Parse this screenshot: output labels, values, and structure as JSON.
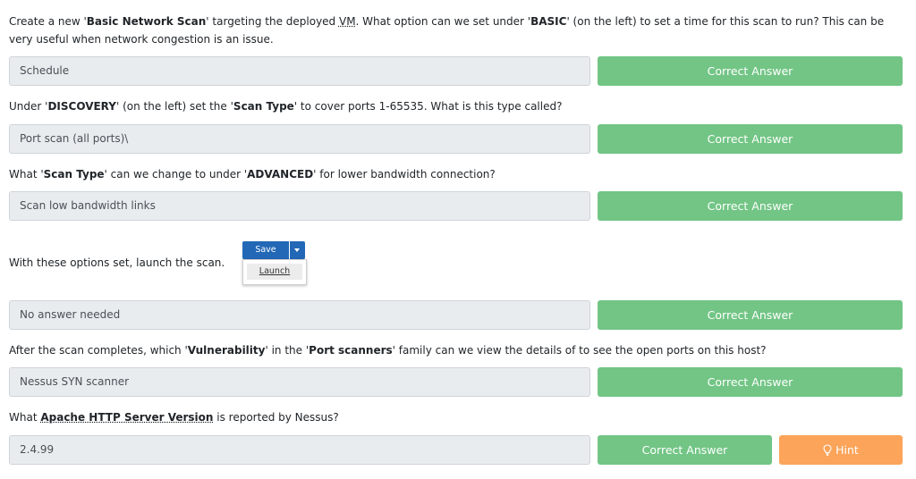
{
  "questions": [
    {
      "q_parts": [
        "Create a new '",
        "Basic Network Scan",
        "' targeting the deployed ",
        "VM",
        ". What option can we set under '",
        "BASIC",
        "' (on the left) to set a time for this scan to run? This can be very useful when network congestion is an issue."
      ],
      "answer": "Schedule",
      "button": "Correct Answer"
    },
    {
      "q_parts": [
        "Under '",
        "DISCOVERY",
        "' (on the left) set the '",
        "Scan Type",
        "' to cover ports 1-65535. What is this type called?"
      ],
      "answer": "Port scan (all ports)\\",
      "button": "Correct Answer"
    },
    {
      "q_parts": [
        "What '",
        "Scan Type",
        "' can we change to under '",
        "ADVANCED",
        "' for lower bandwidth connection?"
      ],
      "answer": "Scan low bandwidth links",
      "button": "Correct Answer"
    },
    {
      "q_text": "With these options set,  launch the scan.",
      "answer": "No answer needed",
      "button": "Correct Answer"
    },
    {
      "q_parts": [
        "After the scan completes, which '",
        "Vulnerability",
        "' in the '",
        "Port scanners",
        "' family can we view the details of to see the open ports on this host?"
      ],
      "answer": "Nessus SYN scanner",
      "button": "Correct Answer"
    },
    {
      "q_parts": [
        "What ",
        "Apache HTTP Server Version",
        " is reported by Nessus?"
      ],
      "answer": "2.4.99",
      "button": "Correct Answer",
      "hint": "Hint"
    }
  ],
  "nessus_widget": {
    "save": "Save",
    "launch": "Launch"
  },
  "colors": {
    "correct": "#72c585",
    "hint": "#fba45a",
    "save": "#2268b6",
    "answer_bg": "#e9ecef"
  },
  "icons": {
    "hint": "lightbulb-icon",
    "dropdown": "caret-down-icon"
  }
}
